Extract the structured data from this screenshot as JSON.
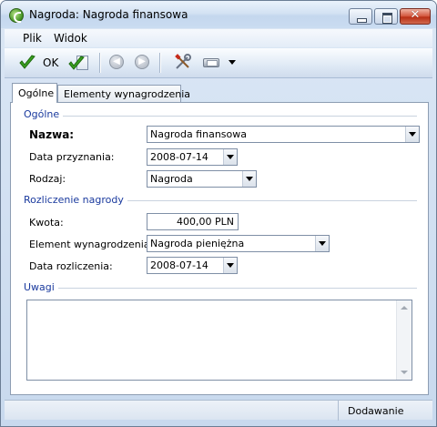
{
  "window": {
    "title": "Nagroda: Nagroda finansowa"
  },
  "menu": {
    "items": [
      "Plik",
      "Widok"
    ]
  },
  "toolbar": {
    "ok_label": "OK",
    "icons": [
      "ok-check-icon",
      "ok-new-icon",
      "back-arrow-icon",
      "forward-arrow-icon",
      "tools-icon",
      "print-icon",
      "print-dropdown-icon"
    ]
  },
  "tabs": [
    {
      "label": "Ogólne",
      "active": true
    },
    {
      "label": "Elementy wynagrodzenia",
      "active": false
    }
  ],
  "section_general": {
    "title": "Ogólne",
    "name_label": "Nazwa:",
    "name_value": "Nagroda finansowa",
    "date_granted_label": "Data przyznania:",
    "date_granted_value": "2008-07-14",
    "type_label": "Rodzaj:",
    "type_value": "Nagroda"
  },
  "section_settlement": {
    "title": "Rozliczenie nagrody",
    "amount_label": "Kwota:",
    "amount_value": "400,00 PLN",
    "element_label": "Element wynagrodzenia:",
    "element_value": "Nagroda pieniężna",
    "settlement_date_label": "Data rozliczenia:",
    "settlement_date_value": "2008-07-14"
  },
  "section_notes": {
    "title": "Uwagi",
    "value": ""
  },
  "status": {
    "mode": "Dodawanie"
  },
  "colors": {
    "section_title": "#1a3a9e",
    "ok_check": "#3aa020"
  }
}
